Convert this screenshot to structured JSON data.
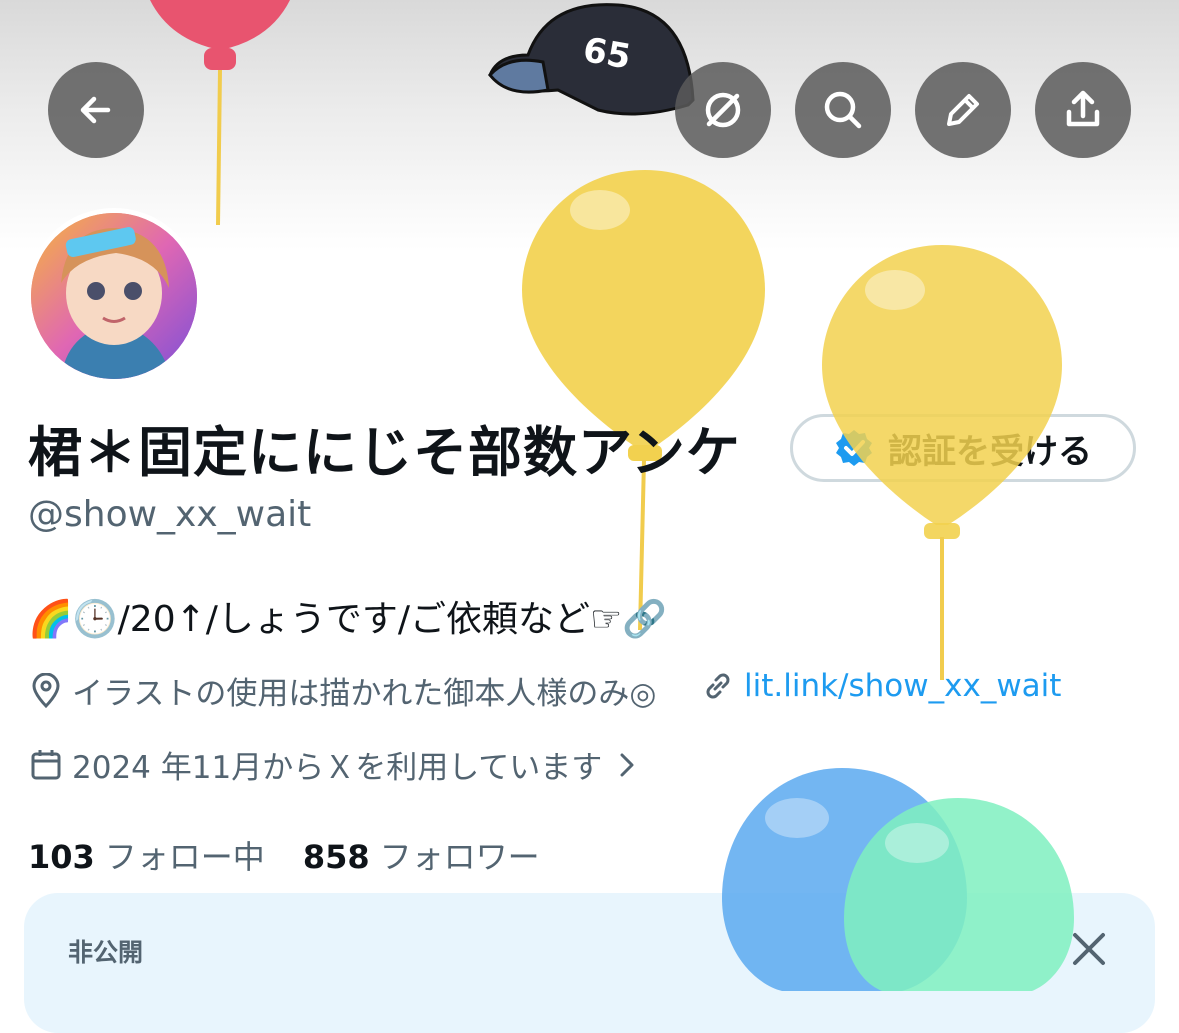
{
  "header": {
    "buttons": [
      "back",
      "grok",
      "search",
      "edit",
      "share"
    ]
  },
  "profile": {
    "name": "桾＊固定ににじそ部数アンケ",
    "handle": "@show_xx_wait",
    "verify_label": "認証を受ける",
    "bio_emoji_prefix": "🌈🕒",
    "bio_text": "/20↑/しょうです/ご依頼など☞🔗",
    "location": "イラストの使用は描かれた御本人様のみ◎",
    "link": "lit.link/show_xx_wait",
    "joined": "2024 年11月からＸを利用しています",
    "following_count": "103",
    "following_label": "フォロー中",
    "followers_count": "858",
    "followers_label": "フォロワー"
  },
  "card": {
    "title": "非公開"
  },
  "colors": {
    "accent": "#1d9bf0",
    "secondary_text": "#536471",
    "card_bg": "#e8f5fd"
  },
  "icons": [
    "back-arrow-icon",
    "grok-icon",
    "search-icon",
    "pencil-icon",
    "share-icon",
    "verified-badge-icon",
    "location-pin-icon",
    "link-icon",
    "calendar-icon",
    "chevron-right-icon",
    "close-icon"
  ]
}
